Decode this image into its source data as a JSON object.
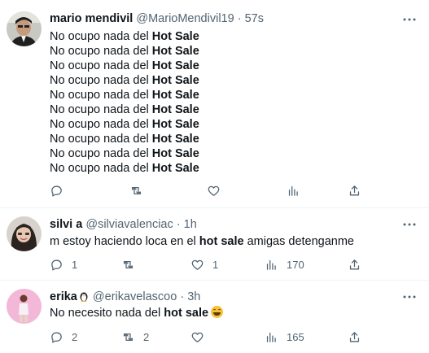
{
  "tweets": [
    {
      "name": "mario mendivil",
      "handle": "@MarioMendivil19",
      "dot": "·",
      "time": "57s",
      "more_icon": "more-icon",
      "lines": [
        {
          "pre": "No ocupo nada del ",
          "bold": "Hot Sale",
          "post": ""
        },
        {
          "pre": "No ocupo nada del ",
          "bold": "Hot Sale",
          "post": ""
        },
        {
          "pre": "No ocupo nada del ",
          "bold": "Hot Sale",
          "post": ""
        },
        {
          "pre": "No ocupo nada del ",
          "bold": "Hot Sale",
          "post": ""
        },
        {
          "pre": "No ocupo nada del ",
          "bold": "Hot Sale",
          "post": ""
        },
        {
          "pre": "No ocupo nada del ",
          "bold": "Hot Sale",
          "post": ""
        },
        {
          "pre": "No ocupo nada del ",
          "bold": "Hot Sale",
          "post": ""
        },
        {
          "pre": "No ocupo nada del ",
          "bold": "Hot Sale",
          "post": ""
        },
        {
          "pre": "No ocupo nada del ",
          "bold": "Hot Sale",
          "post": ""
        },
        {
          "pre": "No ocupo nada del ",
          "bold": "Hot Sale",
          "post": ""
        }
      ],
      "replies": "",
      "retweets": "",
      "likes": "",
      "views": ""
    },
    {
      "name": "silvi a",
      "handle": "@silviavalenciac",
      "dot": "·",
      "time": "1h",
      "lines": [
        {
          "pre": "m  estoy haciendo loca en el ",
          "bold": "hot sale",
          "post": " amigas detenganme"
        }
      ],
      "replies": "1",
      "retweets": "",
      "likes": "1",
      "views": "170"
    },
    {
      "name": "erika",
      "handle": "@erikavelascoo",
      "dot": "·",
      "time": "3h",
      "lines": [
        {
          "pre": "No necesito nada del ",
          "bold": "hot sale",
          "post": ""
        }
      ],
      "replies": "2",
      "retweets": "2",
      "likes": "",
      "views": "165"
    }
  ],
  "colors": {
    "text": "#0f1419",
    "secondary": "#536471",
    "divider": "#eff3f4"
  }
}
